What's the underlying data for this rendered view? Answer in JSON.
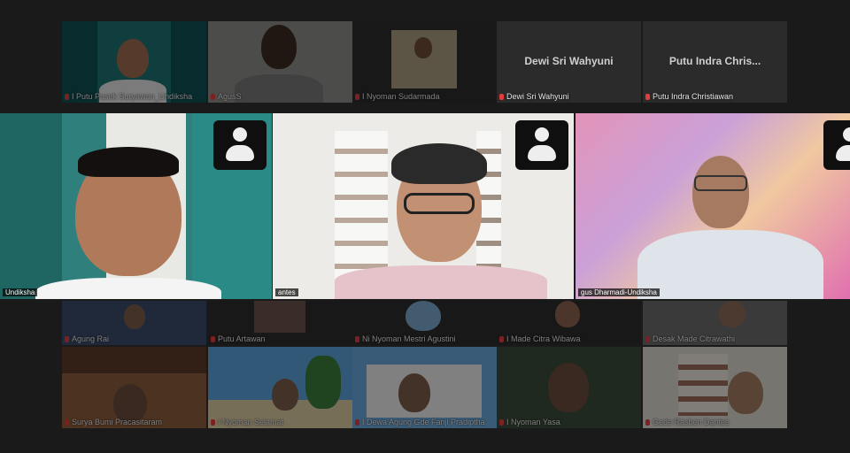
{
  "top_row": [
    {
      "name": "I Putu Pasek Suryawan_Undiksha"
    },
    {
      "name": "AgusS"
    },
    {
      "name": "I Nyoman Sudarmada"
    },
    {
      "name": "Dewi Sri Wahyuni",
      "display_name": "Dewi Sri Wahyuni"
    },
    {
      "name": "Putu Indra Christiawan",
      "display_name": "Putu Indra Chris..."
    }
  ],
  "featured": [
    {
      "name": "Undiksha"
    },
    {
      "name": "antes"
    },
    {
      "name": "gus Dharmadi-Undiksha"
    }
  ],
  "middle_row": [
    {
      "name": "Agung Rai"
    },
    {
      "name": "Putu Artawan"
    },
    {
      "name": "Ni Nyoman Mestri Agustini"
    },
    {
      "name": "I Made Citra Wibawa"
    },
    {
      "name": "Desak Made Citrawathi"
    }
  ],
  "bottom_row": [
    {
      "name": "Surya Bumi Pracasitaram"
    },
    {
      "name": "I Nyoman Selamat"
    },
    {
      "name": "I Dewa Agung Gde Fanji Pradiptha"
    },
    {
      "name": "I Nyoman Yasa"
    },
    {
      "name": "Gede Rasben Dantes"
    }
  ],
  "colors": {
    "background": "#1a1a1a",
    "tile": "#2b2b2b",
    "mic_muted": "#e23c3c"
  }
}
